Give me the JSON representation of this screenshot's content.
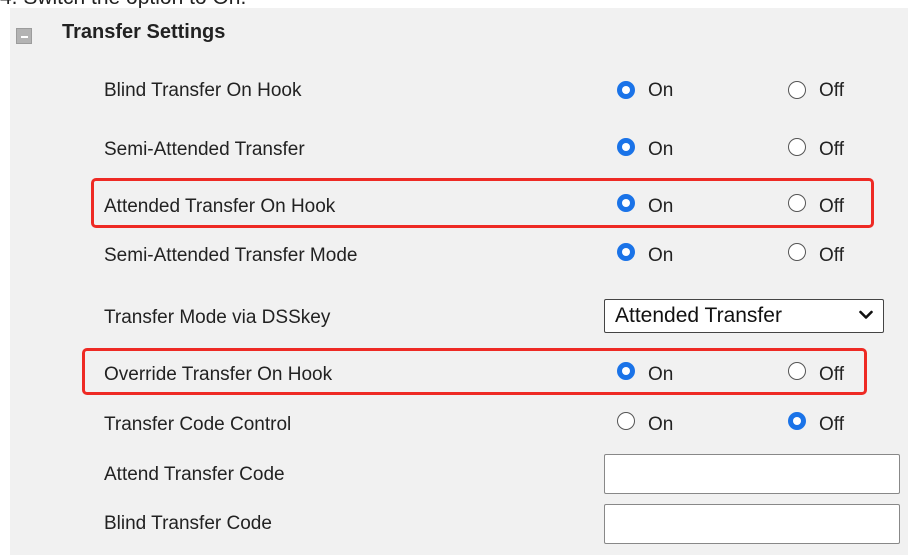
{
  "caption": "4.  Switch the option to On.",
  "section": {
    "title": "Transfer Settings"
  },
  "radio_labels": {
    "on": "On",
    "off": "Off"
  },
  "rows": [
    {
      "label": "Blind Transfer On Hook",
      "value": "On",
      "highlighted": false
    },
    {
      "label": "Semi-Attended Transfer",
      "value": "On",
      "highlighted": false
    },
    {
      "label": "Attended Transfer On Hook",
      "value": "On",
      "highlighted": true
    },
    {
      "label": "Semi-Attended Transfer Mode",
      "value": "On",
      "highlighted": false
    },
    {
      "label": "Transfer Mode via DSSkey",
      "control": "select",
      "selected": "Attended Transfer"
    },
    {
      "label": "Override Transfer On Hook",
      "value": "On",
      "highlighted": true
    },
    {
      "label": "Transfer Code Control",
      "value": "Off",
      "highlighted": false
    },
    {
      "label": "Attend Transfer Code",
      "control": "text",
      "value": ""
    },
    {
      "label": "Blind Transfer Code",
      "control": "text",
      "value": ""
    }
  ],
  "colors": {
    "highlight": "#ee2a24",
    "radio_selected": "#1a73e8",
    "panel_bg": "#f1f1f1"
  },
  "icons": {
    "collapse": "minus-square-icon",
    "dropdown": "chevron-down-icon"
  }
}
